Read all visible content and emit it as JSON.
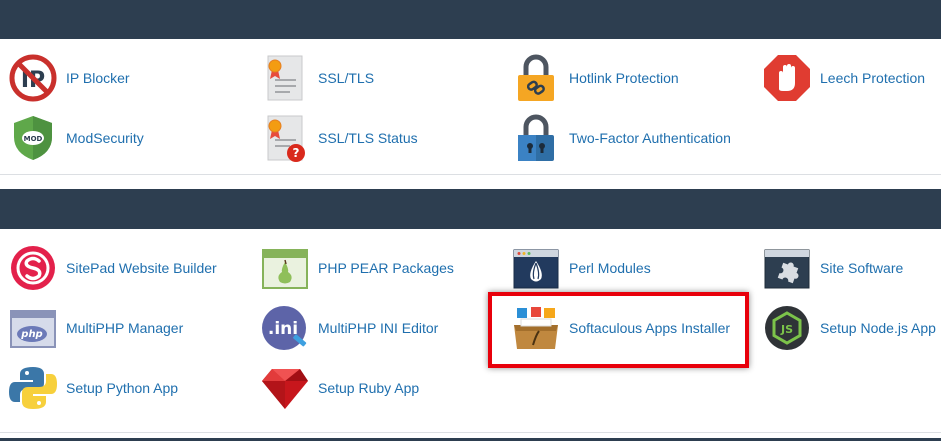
{
  "security": {
    "items": [
      {
        "label": "IP Blocker",
        "icon": "ip-blocker-icon"
      },
      {
        "label": "SSL/TLS",
        "icon": "certificate-icon"
      },
      {
        "label": "Hotlink Protection",
        "icon": "padlock-link-icon"
      },
      {
        "label": "Leech Protection",
        "icon": "stop-hand-icon"
      },
      {
        "label": "ModSecurity",
        "icon": "mod-shield-icon"
      },
      {
        "label": "SSL/TLS Status",
        "icon": "certificate-question-icon"
      },
      {
        "label": "Two-Factor Authentication",
        "icon": "padlock-blue-icon"
      }
    ]
  },
  "software": {
    "items": [
      {
        "label": "SitePad Website Builder",
        "icon": "sitepad-icon"
      },
      {
        "label": "PHP PEAR Packages",
        "icon": "php-pear-icon"
      },
      {
        "label": "Perl Modules",
        "icon": "perl-onion-icon"
      },
      {
        "label": "Site Software",
        "icon": "puzzle-window-icon"
      },
      {
        "label": "MultiPHP Manager",
        "icon": "php-window-icon"
      },
      {
        "label": "MultiPHP INI Editor",
        "icon": "ini-editor-icon"
      },
      {
        "label": "Softaculous Apps Installer",
        "icon": "softaculous-box-icon"
      },
      {
        "label": "Setup Node.js App",
        "icon": "nodejs-icon"
      },
      {
        "label": "Setup Python App",
        "icon": "python-icon"
      },
      {
        "label": "Setup Ruby App",
        "icon": "ruby-gem-icon"
      }
    ]
  },
  "colors": {
    "header": "#2d3e50",
    "link": "#1f6fae",
    "highlight": "#e8000b"
  }
}
